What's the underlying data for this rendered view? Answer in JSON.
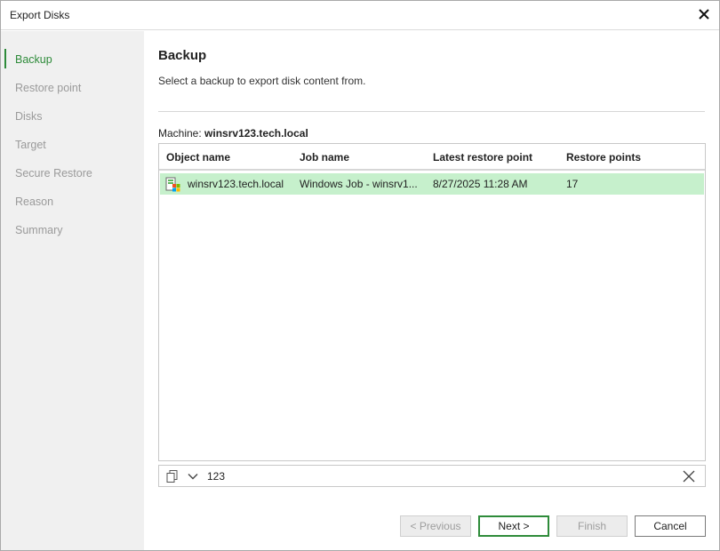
{
  "window": {
    "title": "Export Disks"
  },
  "sidebar": {
    "steps": [
      {
        "label": "Backup",
        "active": true
      },
      {
        "label": "Restore point",
        "active": false
      },
      {
        "label": "Disks",
        "active": false
      },
      {
        "label": "Target",
        "active": false
      },
      {
        "label": "Secure Restore",
        "active": false
      },
      {
        "label": "Reason",
        "active": false
      },
      {
        "label": "Summary",
        "active": false
      }
    ]
  },
  "main": {
    "heading": "Backup",
    "subtitle": "Select a backup to export disk content from.",
    "machine_label": "Machine:",
    "machine_value": "winsrv123.tech.local",
    "table": {
      "columns": [
        "Object name",
        "Job name",
        "Latest restore point",
        "Restore points"
      ],
      "rows": [
        {
          "object_name": "winsrv123.tech.local",
          "job_name": "Windows Job - winsrv1...",
          "latest_restore_point": "8/27/2025 11:28 AM",
          "restore_points": "17",
          "selected": true
        }
      ]
    },
    "filter": {
      "value": "123"
    }
  },
  "footer": {
    "previous_label": "< Previous",
    "next_label": "Next >",
    "finish_label": "Finish",
    "cancel_label": "Cancel"
  },
  "colors": {
    "accent": "#2e8b3a",
    "selected_row": "#c6f0cc",
    "sidebar_bg": "#f0f0f0"
  }
}
